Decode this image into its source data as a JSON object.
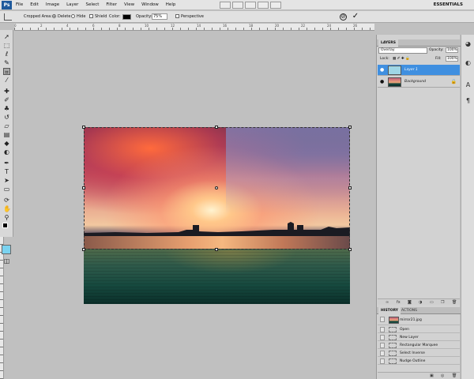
{
  "menubar": {
    "logo": "Ps",
    "items": [
      "File",
      "Edit",
      "Image",
      "Layer",
      "Select",
      "Filter",
      "View",
      "Window",
      "Help"
    ],
    "workspace": "ESSENTIALS"
  },
  "options": {
    "cropped_areas_label": "Cropped Area:",
    "delete_label": "Delete",
    "hide_label": "Hide",
    "shield_label": "Shield",
    "color_label": "Color:",
    "color_value": "#000000",
    "opacity_label": "Opacity:",
    "opacity_value": "75%",
    "perspective_label": "Perspective"
  },
  "ruler_ticks": [
    "0",
    "2",
    "4",
    "6",
    "8",
    "10",
    "12",
    "14",
    "16",
    "18",
    "20",
    "22",
    "24",
    "26"
  ],
  "layers_panel": {
    "tabs": [
      "LAYERS"
    ],
    "blend_mode": "Overlay",
    "opacity_label": "Opacity:",
    "opacity_value": "100%",
    "lock_label": "Lock:",
    "fill_label": "Fill:",
    "fill_value": "100%",
    "layers": [
      {
        "name": "Layer 1",
        "selected": true
      },
      {
        "name": "Background",
        "selected": false
      }
    ]
  },
  "history_panel": {
    "tabs": [
      "HISTORY",
      "ACTIONS"
    ],
    "snapshot": "mirror21.jpg",
    "items": [
      "Open",
      "New Layer",
      "Rectangular Marquee",
      "Select Inverse",
      "Nudge Outline"
    ]
  },
  "colors": {
    "selection": "#3f8fe0",
    "foreground": "#000000",
    "background_swatch": "#7bd3f0"
  }
}
